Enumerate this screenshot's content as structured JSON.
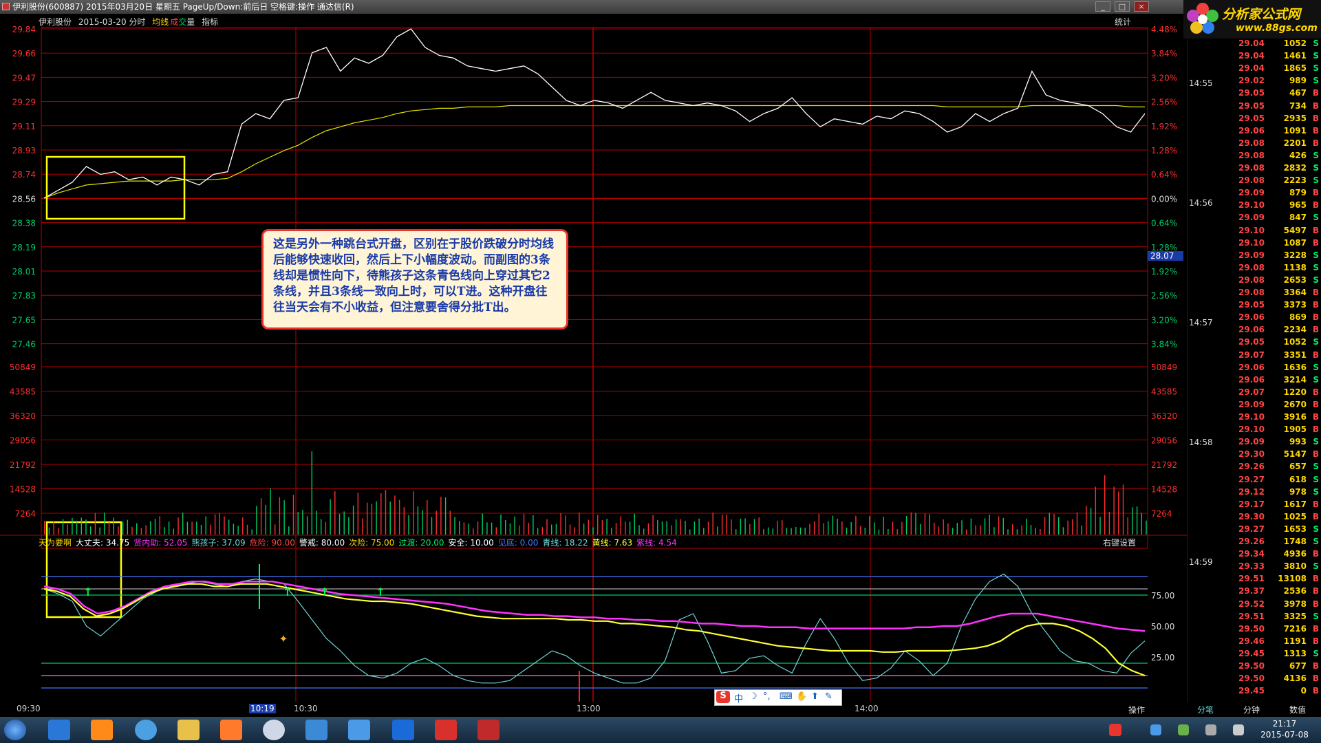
{
  "window": {
    "title": "伊利股份(600887) 2015年03月20日 星期五 PageUp/Down:前后日 空格键:操作 通达信(R)",
    "controls": [
      "_",
      "□",
      "×"
    ]
  },
  "logo": {
    "name": "分析家公式网",
    "url": "www.88gs.com"
  },
  "header": {
    "stock": "伊利股份",
    "date_mode": "2015-03-20 分时",
    "avg_line": "均线",
    "vol_a": "成",
    "vol_b": "交",
    "vol_c": "量",
    "indicator": "指标",
    "stats": "统计"
  },
  "colors": {
    "grid": "#b30000",
    "price": "#ffffff",
    "avg": "#e6e600",
    "up": "#ff3030",
    "down": "#00cc66",
    "cyan": "#6fd6d6",
    "yellow": "#ffff33",
    "magenta": "#ff33ff"
  },
  "axes": {
    "price_left": [
      "29.84",
      "29.66",
      "29.47",
      "29.29",
      "29.11",
      "28.93",
      "28.74",
      "28.56",
      "28.38",
      "28.19",
      "28.01",
      "27.83",
      "27.65",
      "27.46"
    ],
    "pct_right": [
      "4.48%",
      "3.84%",
      "3.20%",
      "2.56%",
      "1.92%",
      "1.28%",
      "0.64%",
      "0.00%",
      "0.64%",
      "1.28%",
      "1.92%",
      "2.56%",
      "3.20%",
      "3.84%"
    ],
    "vol_left": [
      "50849",
      "43585",
      "36320",
      "29056",
      "21792",
      "14528",
      "7264"
    ],
    "vol_right": [
      "50849",
      "43585",
      "36320",
      "29056",
      "21792",
      "14528",
      "7264"
    ],
    "ind_right": [
      "75.00",
      "50.00",
      "25.00"
    ],
    "cursor_price": "28.07",
    "x_labels": [
      "09:30",
      "10:19",
      "10:30",
      "13:00",
      "14:00"
    ]
  },
  "callout": "这是另外一种跳台式开盘，区别在于股价跌破分时均线后能够快速收回，然后上下小幅度波动。而副图的3条线却是惯性向下，待熊孩子这条青色线向上穿过其它2条线，并且3条线一致向上时，可以T进。这种开盘往往当天会有不小收益，但注意要舍得分批T出。",
  "legend": [
    {
      "label": "天为要啊",
      "color": "#ffd700"
    },
    {
      "label": "大丈夫: 34.75",
      "color": "#ffffff"
    },
    {
      "label": "贤内助: 52.05",
      "color": "#ff33ff"
    },
    {
      "label": "熊孩子: 37.09",
      "color": "#6fd6d6"
    },
    {
      "label": "危险: 90.00",
      "color": "#ff4444"
    },
    {
      "label": "警戒: 80.00",
      "color": "#ffffff"
    },
    {
      "label": "次险: 75.00",
      "color": "#ffd700"
    },
    {
      "label": "过渡: 20.00",
      "color": "#00ee66"
    },
    {
      "label": "安全: 10.00",
      "color": "#ffffff"
    },
    {
      "label": "见底: 0.00",
      "color": "#4477ff"
    },
    {
      "label": "青线: 18.22",
      "color": "#6fd6d6"
    },
    {
      "label": "黄线: 7.63",
      "color": "#ffff33"
    },
    {
      "label": "紫线: 4.54",
      "color": "#ff33ff"
    }
  ],
  "right_click": "右键设置",
  "ticks": {
    "times": [
      "14:55",
      "14:56",
      "14:57",
      "14:58",
      "14:59"
    ],
    "rows": [
      [
        "29.04",
        "1052",
        "S"
      ],
      [
        "29.04",
        "1461",
        "S"
      ],
      [
        "29.04",
        "1865",
        "S"
      ],
      [
        "29.02",
        "989",
        "S"
      ],
      [
        "29.05",
        "467",
        "B"
      ],
      [
        "29.05",
        "734",
        "B"
      ],
      [
        "29.05",
        "2935",
        "B"
      ],
      [
        "29.06",
        "1091",
        "B"
      ],
      [
        "29.08",
        "2201",
        "B"
      ],
      [
        "29.08",
        "426",
        "S"
      ],
      [
        "29.08",
        "2832",
        "S"
      ],
      [
        "29.08",
        "2223",
        "S"
      ],
      [
        "29.09",
        "879",
        "B"
      ],
      [
        "29.10",
        "965",
        "B"
      ],
      [
        "29.09",
        "847",
        "S"
      ],
      [
        "29.10",
        "5497",
        "B"
      ],
      [
        "29.10",
        "1087",
        "B"
      ],
      [
        "29.09",
        "3228",
        "S"
      ],
      [
        "29.08",
        "1138",
        "S"
      ],
      [
        "29.08",
        "2653",
        "S"
      ],
      [
        "29.08",
        "3364",
        "B"
      ],
      [
        "29.05",
        "3373",
        "B"
      ],
      [
        "29.06",
        "869",
        "B"
      ],
      [
        "29.06",
        "2234",
        "B"
      ],
      [
        "29.05",
        "1052",
        "S"
      ],
      [
        "29.07",
        "3351",
        "B"
      ],
      [
        "29.06",
        "1636",
        "S"
      ],
      [
        "29.06",
        "3214",
        "S"
      ],
      [
        "29.07",
        "1220",
        "B"
      ],
      [
        "29.09",
        "2670",
        "B"
      ],
      [
        "29.10",
        "3916",
        "B"
      ],
      [
        "29.10",
        "1905",
        "B"
      ],
      [
        "29.09",
        "993",
        "S"
      ],
      [
        "29.30",
        "5147",
        "B"
      ],
      [
        "29.26",
        "657",
        "S"
      ],
      [
        "29.27",
        "618",
        "S"
      ],
      [
        "29.12",
        "978",
        "S"
      ],
      [
        "29.17",
        "1617",
        "B"
      ],
      [
        "29.30",
        "1025",
        "B"
      ],
      [
        "29.27",
        "1653",
        "S"
      ],
      [
        "29.26",
        "1748",
        "S"
      ],
      [
        "29.34",
        "4936",
        "B"
      ],
      [
        "29.33",
        "3810",
        "S"
      ],
      [
        "29.51",
        "13108",
        "B"
      ],
      [
        "29.37",
        "2536",
        "B"
      ],
      [
        "29.52",
        "3978",
        "B"
      ],
      [
        "29.51",
        "3325",
        "S"
      ],
      [
        "29.50",
        "7216",
        "B"
      ],
      [
        "29.46",
        "1191",
        "B"
      ],
      [
        "29.45",
        "1313",
        "S"
      ],
      [
        "29.50",
        "677",
        "B"
      ],
      [
        "29.50",
        "4136",
        "B"
      ],
      [
        "29.45",
        "0",
        "B"
      ]
    ]
  },
  "bottom_tabs": [
    "操作",
    "分笔",
    "分钟",
    "数值"
  ],
  "ime": "中",
  "clock": {
    "time": "21:17",
    "date": "2015-07-08"
  },
  "chart_data": {
    "type": "line",
    "title": "",
    "price_series": [
      28.56,
      28.62,
      28.68,
      28.8,
      28.74,
      28.76,
      28.7,
      28.72,
      28.66,
      28.72,
      28.7,
      28.66,
      28.74,
      28.76,
      29.12,
      29.2,
      29.16,
      29.3,
      29.32,
      29.66,
      29.7,
      29.52,
      29.62,
      29.58,
      29.64,
      29.78,
      29.84,
      29.7,
      29.64,
      29.62,
      29.56,
      29.54,
      29.52,
      29.54,
      29.56,
      29.5,
      29.4,
      29.3,
      29.26,
      29.3,
      29.28,
      29.24,
      29.3,
      29.36,
      29.3,
      29.28,
      29.26,
      29.28,
      29.26,
      29.22,
      29.14,
      29.2,
      29.24,
      29.32,
      29.2,
      29.1,
      29.16,
      29.14,
      29.12,
      29.18,
      29.16,
      29.22,
      29.2,
      29.14,
      29.06,
      29.1,
      29.2,
      29.14,
      29.2,
      29.24,
      29.52,
      29.34,
      29.3,
      29.28,
      29.26,
      29.2,
      29.1,
      29.06,
      29.2
    ],
    "avg_series": [
      28.56,
      28.6,
      28.63,
      28.66,
      28.67,
      28.68,
      28.69,
      28.69,
      28.69,
      28.69,
      28.7,
      28.7,
      28.7,
      28.71,
      28.76,
      28.82,
      28.87,
      28.92,
      28.96,
      29.02,
      29.07,
      29.1,
      29.13,
      29.15,
      29.17,
      29.2,
      29.22,
      29.23,
      29.24,
      29.24,
      29.25,
      29.25,
      29.25,
      29.26,
      29.26,
      29.26,
      29.26,
      29.26,
      29.26,
      29.26,
      29.26,
      29.26,
      29.26,
      29.26,
      29.26,
      29.26,
      29.26,
      29.26,
      29.26,
      29.26,
      29.26,
      29.26,
      29.26,
      29.26,
      29.26,
      29.26,
      29.26,
      29.26,
      29.26,
      29.26,
      29.26,
      29.26,
      29.26,
      29.26,
      29.25,
      29.25,
      29.25,
      29.25,
      29.25,
      29.25,
      29.26,
      29.26,
      29.26,
      29.26,
      29.26,
      29.26,
      29.26,
      29.25,
      29.25
    ],
    "price_ylim": [
      27.46,
      29.84
    ],
    "volume_ylim": [
      0,
      58113
    ],
    "indicator_ylim": [
      0,
      100
    ],
    "indicator_cyan": [
      80,
      76,
      70,
      50,
      42,
      52,
      62,
      72,
      78,
      82,
      84,
      86,
      84,
      82,
      86,
      88,
      86,
      84,
      70,
      55,
      40,
      30,
      18,
      10,
      8,
      12,
      20,
      24,
      18,
      10,
      6,
      4,
      4,
      6,
      14,
      22,
      30,
      26,
      18,
      12,
      8,
      4,
      4,
      8,
      22,
      55,
      60,
      38,
      12,
      14,
      24,
      26,
      18,
      12,
      36,
      56,
      40,
      20,
      6,
      8,
      16,
      30,
      22,
      10,
      20,
      50,
      72,
      86,
      92,
      82,
      60,
      45,
      30,
      22,
      20,
      14,
      12,
      28,
      38
    ],
    "indicator_yellow": [
      80,
      78,
      74,
      64,
      58,
      60,
      64,
      70,
      76,
      80,
      82,
      84,
      84,
      82,
      82,
      84,
      84,
      84,
      82,
      80,
      78,
      76,
      74,
      72,
      71,
      70,
      70,
      69,
      68,
      66,
      64,
      62,
      60,
      58,
      57,
      56,
      56,
      56,
      56,
      56,
      55,
      55,
      54,
      54,
      52,
      52,
      51,
      50,
      49,
      47,
      46,
      44,
      42,
      40,
      38,
      36,
      34,
      33,
      32,
      31,
      30,
      30,
      30,
      30,
      29,
      29,
      30,
      30,
      30,
      30,
      31,
      32,
      34,
      38,
      45,
      50,
      52,
      52,
      50,
      46,
      40,
      32,
      20,
      14,
      10
    ],
    "indicator_magenta": [
      82,
      80,
      76,
      66,
      60,
      62,
      66,
      72,
      78,
      82,
      84,
      86,
      86,
      84,
      84,
      86,
      86,
      86,
      84,
      82,
      80,
      78,
      76,
      75,
      74,
      73,
      72,
      71,
      70,
      69,
      68,
      66,
      64,
      62,
      61,
      60,
      59,
      59,
      58,
      58,
      57,
      57,
      56,
      56,
      55,
      55,
      54,
      54,
      53,
      52,
      52,
      51,
      50,
      50,
      49,
      49,
      49,
      48,
      48,
      48,
      48,
      48,
      48,
      48,
      48,
      49,
      49,
      50,
      50,
      52,
      55,
      58,
      60,
      60,
      60,
      58,
      56,
      54,
      52,
      50,
      48,
      47,
      46
    ]
  }
}
